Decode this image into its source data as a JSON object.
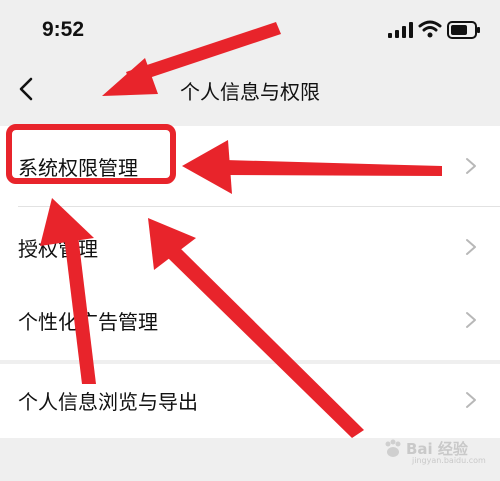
{
  "status_bar": {
    "time": "9:52",
    "signal_icon": "signal-icon",
    "wifi_icon": "wifi-icon",
    "battery_icon": "battery-icon"
  },
  "nav": {
    "back_icon": "chevron-left-icon",
    "title": "个人信息与权限"
  },
  "groups": [
    {
      "items": [
        {
          "label": "系统权限管理"
        },
        {
          "label": "授权管理"
        }
      ]
    },
    {
      "items": [
        {
          "label": "个性化广告管理"
        }
      ]
    },
    {
      "items": [
        {
          "label": "个人信息浏览与导出"
        }
      ]
    }
  ],
  "annotations": {
    "highlighted_item": "系统权限管理",
    "arrow_color": "#e8242b"
  },
  "watermark": {
    "text": "Bai 经验",
    "sub": "jingyan.baidu.com"
  }
}
